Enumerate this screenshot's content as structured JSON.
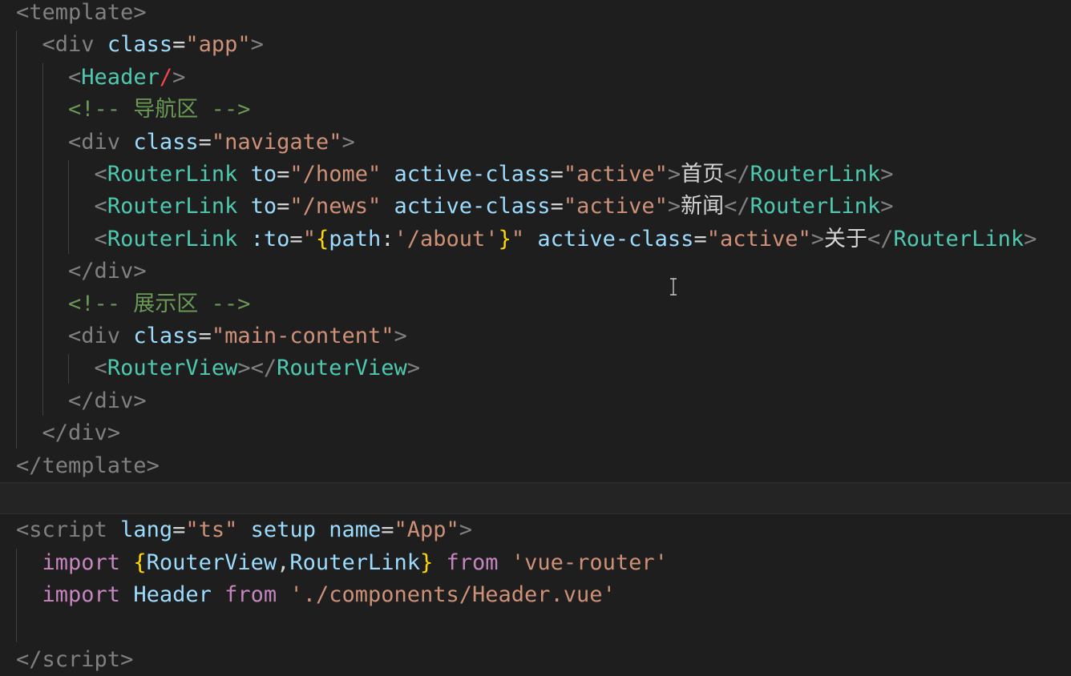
{
  "editor": {
    "language": "vue",
    "lines": [
      [
        {
          "t": "<",
          "c": "punct"
        },
        {
          "t": "template",
          "c": "punct"
        },
        {
          "t": ">",
          "c": "punct"
        }
      ],
      [
        {
          "t": "  ",
          "c": "text"
        },
        {
          "t": "<",
          "c": "punct"
        },
        {
          "t": "div",
          "c": "punct"
        },
        {
          "t": " ",
          "c": "text"
        },
        {
          "t": "class",
          "c": "attr"
        },
        {
          "t": "=",
          "c": "eq"
        },
        {
          "t": "\"app\"",
          "c": "str"
        },
        {
          "t": ">",
          "c": "punct"
        }
      ],
      [
        {
          "t": "    ",
          "c": "text"
        },
        {
          "t": "<",
          "c": "punct"
        },
        {
          "t": "Header",
          "c": "tag"
        },
        {
          "t": "/",
          "c": "slash-red"
        },
        {
          "t": ">",
          "c": "punct"
        }
      ],
      [
        {
          "t": "    ",
          "c": "text"
        },
        {
          "t": "<!-- 导航区 -->",
          "c": "comment"
        }
      ],
      [
        {
          "t": "    ",
          "c": "text"
        },
        {
          "t": "<",
          "c": "punct"
        },
        {
          "t": "div",
          "c": "punct"
        },
        {
          "t": " ",
          "c": "text"
        },
        {
          "t": "class",
          "c": "attr"
        },
        {
          "t": "=",
          "c": "eq"
        },
        {
          "t": "\"navigate\"",
          "c": "str"
        },
        {
          "t": ">",
          "c": "punct"
        }
      ],
      [
        {
          "t": "      ",
          "c": "text"
        },
        {
          "t": "<",
          "c": "punct"
        },
        {
          "t": "RouterLink",
          "c": "tag"
        },
        {
          "t": " ",
          "c": "text"
        },
        {
          "t": "to",
          "c": "attr"
        },
        {
          "t": "=",
          "c": "eq"
        },
        {
          "t": "\"/home\"",
          "c": "str"
        },
        {
          "t": " ",
          "c": "text"
        },
        {
          "t": "active-class",
          "c": "attr"
        },
        {
          "t": "=",
          "c": "eq"
        },
        {
          "t": "\"active\"",
          "c": "str"
        },
        {
          "t": ">",
          "c": "punct"
        },
        {
          "t": "首页",
          "c": "text"
        },
        {
          "t": "</",
          "c": "punct"
        },
        {
          "t": "RouterLink",
          "c": "tag"
        },
        {
          "t": ">",
          "c": "punct"
        }
      ],
      [
        {
          "t": "      ",
          "c": "text"
        },
        {
          "t": "<",
          "c": "punct"
        },
        {
          "t": "RouterLink",
          "c": "tag"
        },
        {
          "t": " ",
          "c": "text"
        },
        {
          "t": "to",
          "c": "attr"
        },
        {
          "t": "=",
          "c": "eq"
        },
        {
          "t": "\"/news\"",
          "c": "str"
        },
        {
          "t": " ",
          "c": "text"
        },
        {
          "t": "active-class",
          "c": "attr"
        },
        {
          "t": "=",
          "c": "eq"
        },
        {
          "t": "\"active\"",
          "c": "str"
        },
        {
          "t": ">",
          "c": "punct"
        },
        {
          "t": "新闻",
          "c": "text"
        },
        {
          "t": "</",
          "c": "punct"
        },
        {
          "t": "RouterLink",
          "c": "tag"
        },
        {
          "t": ">",
          "c": "punct"
        }
      ],
      [
        {
          "t": "      ",
          "c": "text"
        },
        {
          "t": "<",
          "c": "punct"
        },
        {
          "t": "RouterLink",
          "c": "tag"
        },
        {
          "t": " ",
          "c": "text"
        },
        {
          "t": ":to",
          "c": "attr"
        },
        {
          "t": "=",
          "c": "eq"
        },
        {
          "t": "\"",
          "c": "str"
        },
        {
          "t": "{",
          "c": "brace"
        },
        {
          "t": "path",
          "c": "var"
        },
        {
          "t": ":",
          "c": "text"
        },
        {
          "t": "'/about'",
          "c": "str"
        },
        {
          "t": "}",
          "c": "brace"
        },
        {
          "t": "\"",
          "c": "str"
        },
        {
          "t": " ",
          "c": "text"
        },
        {
          "t": "active-class",
          "c": "attr"
        },
        {
          "t": "=",
          "c": "eq"
        },
        {
          "t": "\"active\"",
          "c": "str"
        },
        {
          "t": ">",
          "c": "punct"
        },
        {
          "t": "关于",
          "c": "text"
        },
        {
          "t": "</",
          "c": "punct"
        },
        {
          "t": "RouterLink",
          "c": "tag"
        },
        {
          "t": ">",
          "c": "punct"
        }
      ],
      [
        {
          "t": "    ",
          "c": "text"
        },
        {
          "t": "</",
          "c": "punct"
        },
        {
          "t": "div",
          "c": "punct"
        },
        {
          "t": ">",
          "c": "punct"
        }
      ],
      [
        {
          "t": "    ",
          "c": "text"
        },
        {
          "t": "<!-- 展示区 -->",
          "c": "comment"
        }
      ],
      [
        {
          "t": "    ",
          "c": "text"
        },
        {
          "t": "<",
          "c": "punct"
        },
        {
          "t": "div",
          "c": "punct"
        },
        {
          "t": " ",
          "c": "text"
        },
        {
          "t": "class",
          "c": "attr"
        },
        {
          "t": "=",
          "c": "eq"
        },
        {
          "t": "\"main-content\"",
          "c": "str"
        },
        {
          "t": ">",
          "c": "punct"
        }
      ],
      [
        {
          "t": "      ",
          "c": "text"
        },
        {
          "t": "<",
          "c": "punct"
        },
        {
          "t": "RouterView",
          "c": "tag"
        },
        {
          "t": "></",
          "c": "punct"
        },
        {
          "t": "RouterView",
          "c": "tag"
        },
        {
          "t": ">",
          "c": "punct"
        }
      ],
      [
        {
          "t": "    ",
          "c": "text"
        },
        {
          "t": "</",
          "c": "punct"
        },
        {
          "t": "div",
          "c": "punct"
        },
        {
          "t": ">",
          "c": "punct"
        }
      ],
      [
        {
          "t": "  ",
          "c": "text"
        },
        {
          "t": "</",
          "c": "punct"
        },
        {
          "t": "div",
          "c": "punct"
        },
        {
          "t": ">",
          "c": "punct"
        }
      ],
      [
        {
          "t": "</",
          "c": "punct"
        },
        {
          "t": "template",
          "c": "punct"
        },
        {
          "t": ">",
          "c": "punct"
        }
      ],
      [],
      [
        {
          "t": "<",
          "c": "punct"
        },
        {
          "t": "script",
          "c": "punct"
        },
        {
          "t": " ",
          "c": "text"
        },
        {
          "t": "lang",
          "c": "attr"
        },
        {
          "t": "=",
          "c": "eq"
        },
        {
          "t": "\"ts\"",
          "c": "str"
        },
        {
          "t": " ",
          "c": "text"
        },
        {
          "t": "setup",
          "c": "attr"
        },
        {
          "t": " ",
          "c": "text"
        },
        {
          "t": "name",
          "c": "attr"
        },
        {
          "t": "=",
          "c": "eq"
        },
        {
          "t": "\"App\"",
          "c": "str"
        },
        {
          "t": ">",
          "c": "punct"
        }
      ],
      [
        {
          "t": "  ",
          "c": "text"
        },
        {
          "t": "import",
          "c": "kw"
        },
        {
          "t": " ",
          "c": "text"
        },
        {
          "t": "{",
          "c": "brace"
        },
        {
          "t": "RouterView",
          "c": "import-id"
        },
        {
          "t": ",",
          "c": "text"
        },
        {
          "t": "RouterLink",
          "c": "import-id"
        },
        {
          "t": "}",
          "c": "brace"
        },
        {
          "t": " ",
          "c": "text"
        },
        {
          "t": "from",
          "c": "kw"
        },
        {
          "t": " ",
          "c": "text"
        },
        {
          "t": "'vue-router'",
          "c": "str"
        }
      ],
      [
        {
          "t": "  ",
          "c": "text"
        },
        {
          "t": "import",
          "c": "kw"
        },
        {
          "t": " ",
          "c": "text"
        },
        {
          "t": "Header",
          "c": "import-id"
        },
        {
          "t": " ",
          "c": "text"
        },
        {
          "t": "from",
          "c": "kw"
        },
        {
          "t": " ",
          "c": "text"
        },
        {
          "t": "'./components/Header.vue'",
          "c": "str"
        }
      ],
      [],
      [
        {
          "t": "</",
          "c": "punct"
        },
        {
          "t": "script",
          "c": "punct"
        },
        {
          "t": ">",
          "c": "punct"
        }
      ]
    ],
    "current_line_index": 15,
    "colors": {
      "background": "#1e1e1e",
      "tag_bracket": "#808080",
      "component_tag": "#4ec9b0",
      "attribute": "#9cdcfe",
      "string": "#ce9178",
      "comment": "#6a9955",
      "keyword": "#c586c0",
      "brace": "#ffd700",
      "error_slash": "#f44747",
      "current_line": "#242424"
    }
  },
  "cursor": {
    "icon": "text-ibeam-cursor-icon"
  }
}
